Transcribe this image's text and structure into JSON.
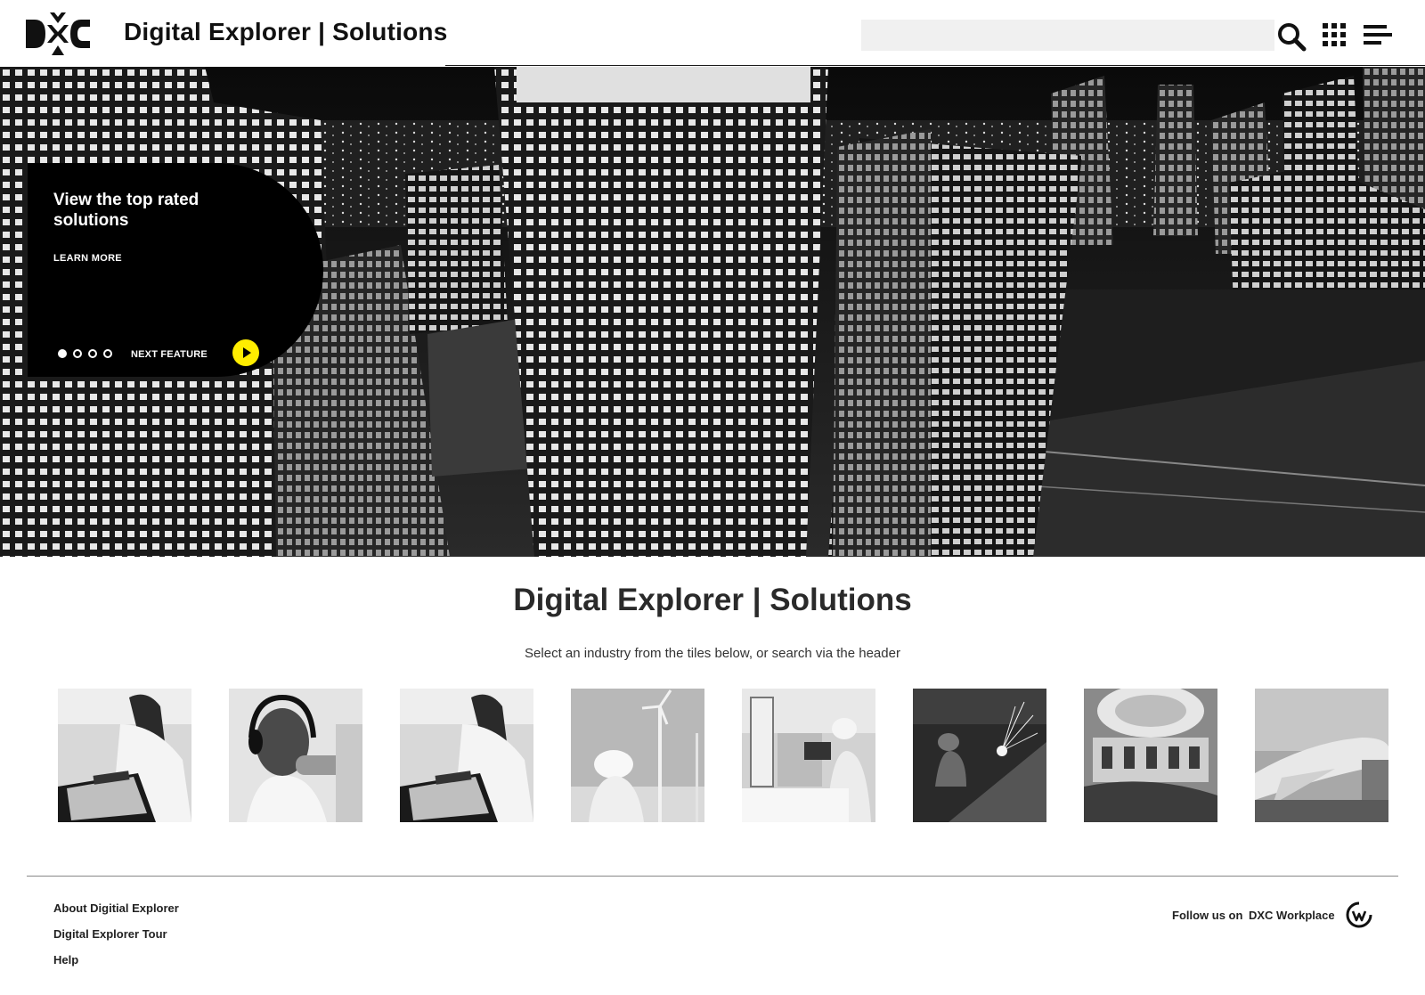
{
  "header": {
    "app_title": "Digital Explorer | Solutions",
    "search_value": "",
    "search_placeholder": ""
  },
  "hero": {
    "feature_title": "View the top rated solutions",
    "learn_more_label": "LEARN MORE",
    "next_feature_label": "NEXT FEATURE",
    "slide_count": 4,
    "active_slide": 1
  },
  "main": {
    "title": "Digital Explorer | Solutions",
    "subtitle": "Select an industry from the tiles below, or search via the header"
  },
  "tiles": [
    {
      "icon": "banking-image"
    },
    {
      "icon": "media-image"
    },
    {
      "icon": "banking-image"
    },
    {
      "icon": "energy-image"
    },
    {
      "icon": "lab-image"
    },
    {
      "icon": "manufacturing-image"
    },
    {
      "icon": "public-sector-image"
    },
    {
      "icon": "aviation-image"
    }
  ],
  "footer": {
    "links": [
      "About Digitial Explorer",
      "Digital Explorer Tour",
      "Help"
    ],
    "follow_label": "Follow us on",
    "follow_link": "DXC Workplace"
  },
  "colors": {
    "accent_yellow": "#ffed00",
    "black": "#000000",
    "text_dark": "#111111"
  }
}
